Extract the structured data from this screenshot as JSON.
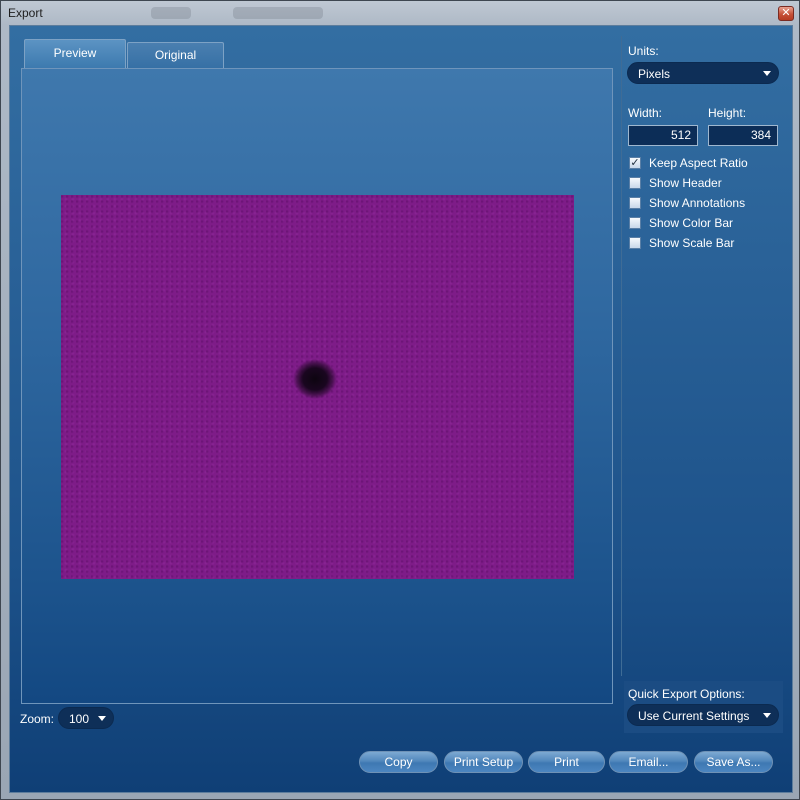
{
  "window": {
    "title": "Export",
    "close_glyph": "✕"
  },
  "tabs": [
    {
      "label": "Preview",
      "active": true
    },
    {
      "label": "Original",
      "active": false
    }
  ],
  "preview": {
    "image_colors": {
      "background": "#7e1c88",
      "spot": "#0d0510"
    }
  },
  "zoom": {
    "label": "Zoom:",
    "value": "100"
  },
  "units": {
    "label": "Units:",
    "value": "Pixels"
  },
  "dimensions": {
    "width_label": "Width:",
    "height_label": "Height:",
    "width_value": "512",
    "height_value": "384"
  },
  "options": [
    {
      "label": "Keep Aspect Ratio",
      "checked": true
    },
    {
      "label": "Show Header",
      "checked": false
    },
    {
      "label": "Show Annotations",
      "checked": false
    },
    {
      "label": "Show Color Bar",
      "checked": false
    },
    {
      "label": "Show Scale Bar",
      "checked": false
    }
  ],
  "quick_export": {
    "label": "Quick Export Options:",
    "value": "Use Current Settings"
  },
  "buttons": {
    "copy": "Copy",
    "print_setup": "Print Setup",
    "print": "Print",
    "email": "Email...",
    "save_as": "Save As..."
  },
  "check_glyph": "✓",
  "icons": {
    "close": "close-icon",
    "dropdown": "chevron-down-icon",
    "checkbox": "checkmark-icon"
  }
}
